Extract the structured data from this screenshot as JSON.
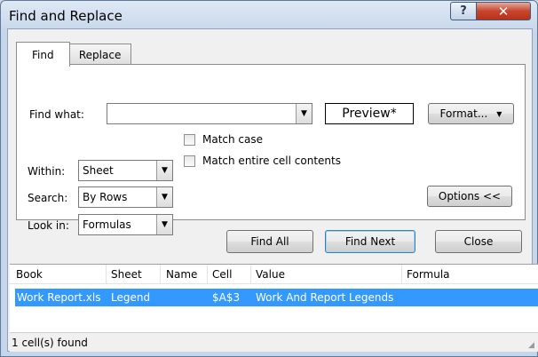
{
  "window": {
    "title": "Find and Replace",
    "help_label": "?",
    "close_label": "✕"
  },
  "tabs": [
    {
      "label": "Find",
      "active": true
    },
    {
      "label": "Replace",
      "active": false
    }
  ],
  "find": {
    "find_what_label": "Find what:",
    "find_what_value": "",
    "preview_label": "Preview*",
    "format_label": "Format...",
    "within_label": "Within:",
    "within_value": "Sheet",
    "search_label": "Search:",
    "search_value": "By Rows",
    "look_in_label": "Look in:",
    "look_in_value": "Formulas",
    "match_case_label": "Match case",
    "match_case_checked": false,
    "match_entire_label": "Match entire cell contents",
    "match_entire_checked": false,
    "options_label": "Options <<"
  },
  "buttons": {
    "find_all": "Find All",
    "find_next": "Find Next",
    "close": "Close"
  },
  "results": {
    "columns": [
      "Book",
      "Sheet",
      "Name",
      "Cell",
      "Value",
      "Formula"
    ],
    "rows": [
      {
        "book": "Work Report.xls",
        "sheet": "Legend",
        "name": "",
        "cell": "$A$3",
        "value": "Work And Report Legends",
        "formula": ""
      }
    ],
    "status": "1 cell(s) found"
  },
  "colors": {
    "selection": "#3399ff",
    "close_button": "#c7452e"
  }
}
